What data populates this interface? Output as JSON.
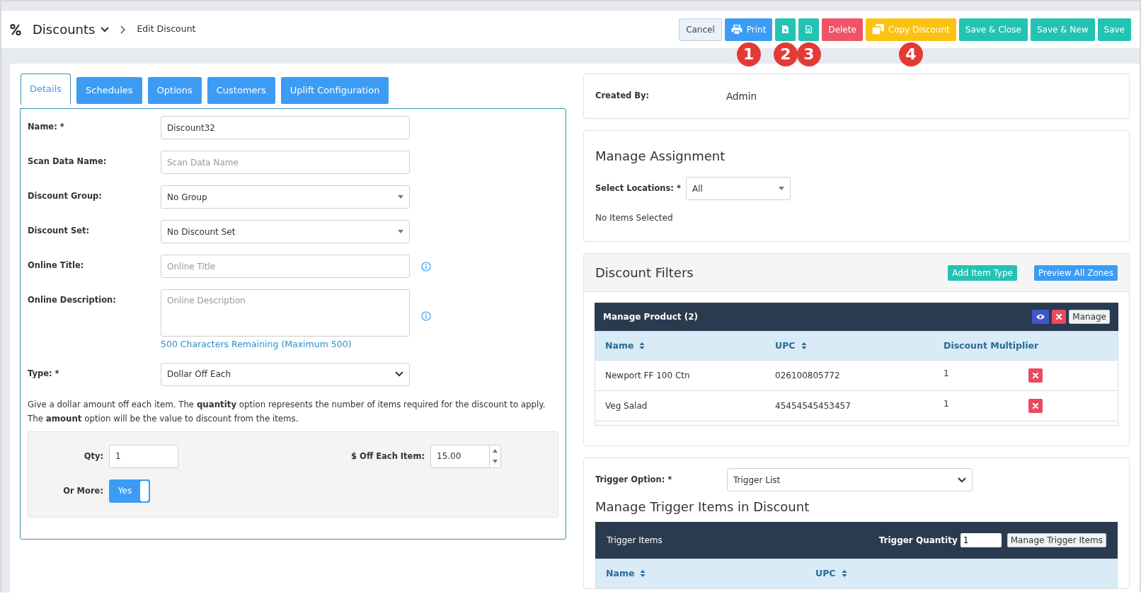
{
  "header": {
    "module": "Discounts",
    "breadcrumb": "Edit Discount"
  },
  "toolbar": [
    {
      "kind": "cancel",
      "label": "Cancel"
    },
    {
      "kind": "print",
      "label": "Print",
      "callout": "1"
    },
    {
      "kind": "add-doc",
      "callout": "2"
    },
    {
      "kind": "doc",
      "callout": "3"
    },
    {
      "kind": "delete",
      "label": "Delete"
    },
    {
      "kind": "copy",
      "label": "Copy Discount",
      "callout": "4"
    },
    {
      "kind": "save",
      "label": "Save & Close"
    },
    {
      "kind": "save",
      "label": "Save & New"
    },
    {
      "kind": "save",
      "label": "Save"
    }
  ],
  "tabs": [
    {
      "label": "Details",
      "selected": true
    },
    {
      "label": "Schedules",
      "selected": false
    },
    {
      "label": "Options",
      "selected": false
    },
    {
      "label": "Customers",
      "selected": false
    },
    {
      "label": "Uplift Configuration",
      "selected": false
    }
  ],
  "fields": [
    {
      "kind": "text",
      "label": "Name: *",
      "value": "Discount32"
    },
    {
      "kind": "text",
      "label": "Scan Data Name:",
      "placeholder": "Scan Data Name"
    },
    {
      "kind": "select",
      "label": "Discount Group:",
      "value": "No Group"
    },
    {
      "kind": "select",
      "label": "Discount Set:",
      "value": "No Discount Set"
    },
    {
      "kind": "text",
      "label": "Online Title:",
      "placeholder": "Online Title",
      "info": true
    },
    {
      "kind": "textarea",
      "label": "Online Description:",
      "placeholder": "Online Description",
      "info": true,
      "hint": "500 Characters Remaining (Maximum 500)"
    },
    {
      "kind": "dropdown",
      "label": "Type: *",
      "value": "Dollar Off Each"
    }
  ],
  "description": "Give a dollar amount off each item. The **quantity** option represents the number of items required for the discount to apply. The **amount** option will be the value to discount from the items.",
  "amounts": {
    "qty_label": "Qty:",
    "qty_value": "1",
    "off_label": "$ Off Each Item:",
    "off_value": "15.00",
    "more_label": "Or More:",
    "more_text": "Yes",
    "more_on": true
  },
  "created_by": {
    "label": "Created By:",
    "value": "Admin"
  },
  "assignment": {
    "title": "Manage Assignment",
    "locations_label": "Select Locations: *",
    "locations_value": "All",
    "status": "No Items Selected"
  },
  "filters": {
    "title": "Discount Filters",
    "buttons": [
      {
        "kind": "teal",
        "label": "Add Item Type"
      },
      {
        "kind": "blue",
        "label": "Preview All Zones"
      }
    ],
    "panel": {
      "title": "Manage Product (2)",
      "manage": "Manage",
      "columns": [
        {
          "label": "Name",
          "sortable": true
        },
        {
          "label": "UPC",
          "sortable": true
        },
        {
          "label": "Discount Multiplier",
          "sortable": false
        }
      ],
      "rows": [
        {
          "name": "Newport FF 100 Ctn",
          "upc": "026100805772",
          "multiplier": "1"
        },
        {
          "name": "Veg Salad",
          "upc": "45454545453457",
          "multiplier": "1"
        }
      ]
    }
  },
  "trigger": {
    "label": "Trigger Option: *",
    "value": "Trigger List",
    "title": "Manage Trigger Items in Discount",
    "panel": {
      "title": "Trigger Items",
      "qty_label": "Trigger Quantity",
      "qty_value": "1",
      "button": "Manage Trigger Items",
      "columns": [
        {
          "label": "Name",
          "sortable": true
        },
        {
          "label": "UPC",
          "sortable": true
        }
      ]
    }
  }
}
